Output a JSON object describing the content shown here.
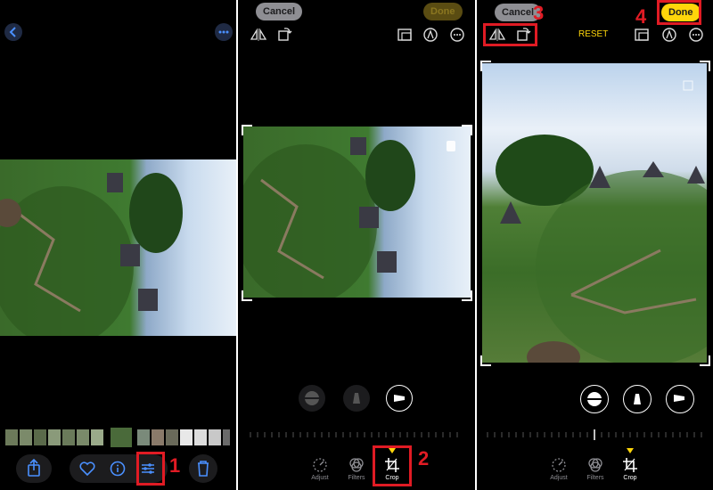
{
  "panel1": {
    "bottom_bar": [
      "share-icon",
      "heart-icon",
      "info-icon",
      "adjust-icon",
      "trash-icon"
    ]
  },
  "panel2": {
    "cancel_label": "Cancel",
    "done_label": "Done",
    "tools": {
      "adjust": "Adjust",
      "filters": "Filters",
      "crop": "Crop"
    }
  },
  "panel3": {
    "cancel_label": "Cancel",
    "done_label": "Done",
    "reset_label": "RESET",
    "tools": {
      "adjust": "Adjust",
      "filters": "Filters",
      "crop": "Crop"
    }
  },
  "annotations": {
    "n1": "1",
    "n2": "2",
    "n3": "3",
    "n4": "4"
  },
  "colors": {
    "accent": "#ffd60a",
    "annotation": "#e01b24",
    "ios_blue": "#0a84ff"
  }
}
